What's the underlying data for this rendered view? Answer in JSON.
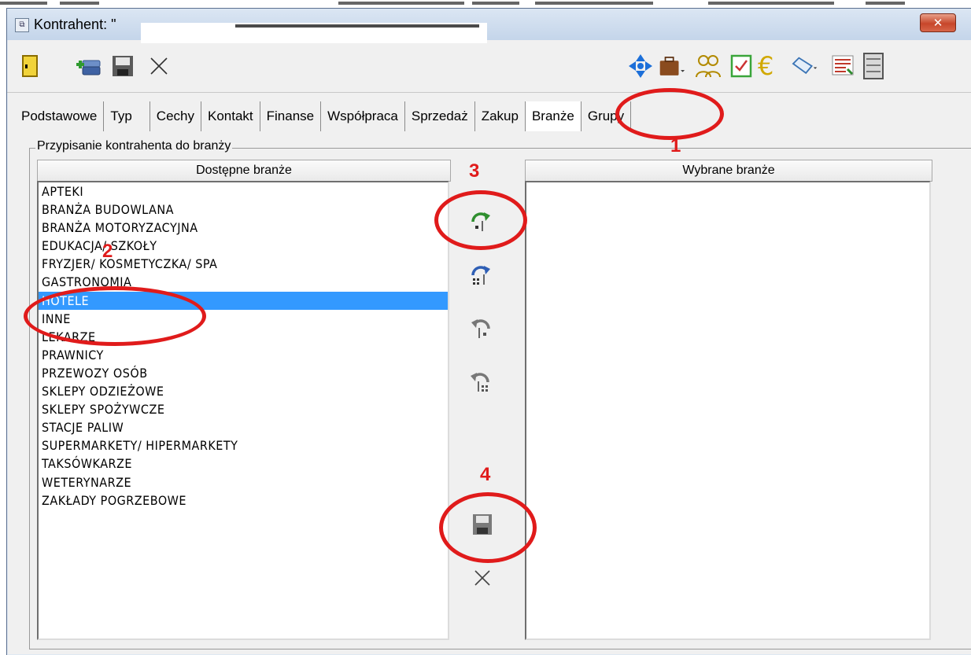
{
  "window": {
    "title": "Kontrahent: \"",
    "close_glyph": "✕"
  },
  "toolbar": {
    "left_icons": [
      "door-exit-icon",
      "add-record-icon",
      "save-icon",
      "cancel-icon"
    ],
    "right_icons": [
      "navigator-icon",
      "briefcase-icon",
      "people-icon",
      "checklist-icon",
      "euro-icon",
      "tag-icon",
      "list-icon",
      "cabinet-icon"
    ]
  },
  "tabs": [
    {
      "label": "Podstawowe"
    },
    {
      "label": "Typ"
    },
    {
      "label": "Cechy"
    },
    {
      "label": "Kontakt"
    },
    {
      "label": "Finanse"
    },
    {
      "label": "Współpraca"
    },
    {
      "label": "Sprzedaż"
    },
    {
      "label": "Zakup"
    },
    {
      "label": "Branże",
      "active": true
    },
    {
      "label": "Grupy"
    }
  ],
  "group": {
    "legend": "Przypisanie kontrahenta do branży",
    "available_header": "Dostępne branże",
    "selected_header": "Wybrane branże",
    "available_items": [
      "APTEKI",
      "BRANŻA BUDOWLANA",
      "BRANŻA MOTORYZACYJNA",
      "EDUKACJA/ SZKOŁY",
      "FRYZJER/ KOSMETYCZKA/ SPA",
      "GASTRONOMIA",
      "HOTELE",
      "INNE",
      "LEKARZE",
      "PRAWNICY",
      "PRZEWOZY OSÓB",
      "SKLEPY ODZIEŻOWE",
      "SKLEPY SPOŻYWCZE",
      "STACJE PALIW",
      "SUPERMARKETY/ HIPERMARKETY",
      "TAKSÓWKARZE",
      "WETERYNARZE",
      "ZAKŁADY POGRZEBOWE"
    ],
    "selected_item": "HOTELE",
    "selected_items": []
  },
  "annotations": {
    "step1": "1",
    "step2": "2",
    "step3": "3",
    "step4": "4",
    "color": "#e01b1b"
  },
  "colors": {
    "selection": "#3399ff",
    "close_button": "#c7462a"
  }
}
